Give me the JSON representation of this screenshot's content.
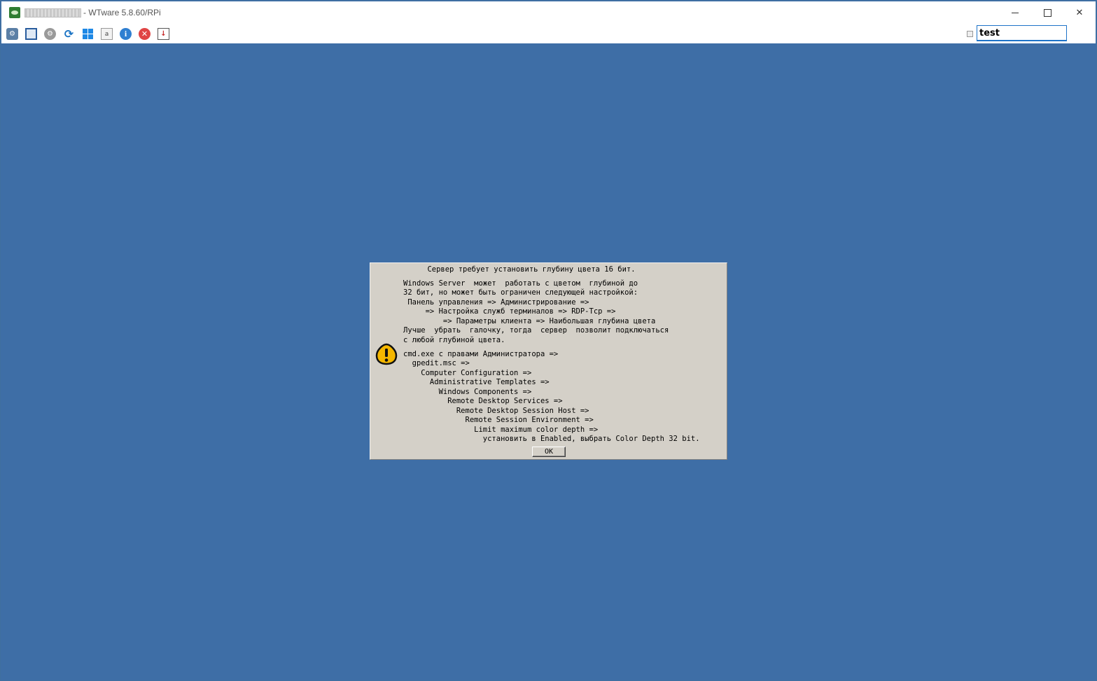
{
  "window": {
    "title": "- WTware 5.8.60/RPi",
    "controls": {
      "minimize_icon": "minimize-icon",
      "maximize_icon": "maximize-icon",
      "close_icon": "close-icon"
    }
  },
  "toolbar": {
    "icons": [
      "plugins-icon",
      "fullscreen-icon",
      "settings-icon",
      "refresh-icon",
      "windows-icon",
      "keyboard-icon",
      "info-icon",
      "stop-icon",
      "disconnect-icon"
    ],
    "search_value": "test"
  },
  "dialog": {
    "title": "Сервер требует установить глубину цвета 16 бит.",
    "body": "Windows Server  может  работать с цветом  глубиной до\n32 бит, но может быть ограничен следующей настройкой:\n Панель управления => Администрирование =>\n     => Настройка служб терминалов => RDP-Tcp =>\n         => Параметры клиента => Наибольшая глубина цвета\nЛучше  убрать  галочку, тогда  сервер  позволит подключаться\nс любой глубиной цвета.",
    "path": "cmd.exe с правами Администратора =>\n  gpedit.msc =>\n    Computer Configuration =>\n      Administrative Templates =>\n        Windows Components =>\n          Remote Desktop Services =>\n            Remote Desktop Session Host =>\n              Remote Session Environment =>\n                Limit maximum color depth =>\n                  установить в Enabled, выбрать Color Depth 32 bit.",
    "ok_label": "OK",
    "icon": "warning-icon"
  },
  "colors": {
    "desktop": "#3e6ea6",
    "dialog_bg": "#d4d0c8",
    "warning_fill": "#f5b700"
  }
}
